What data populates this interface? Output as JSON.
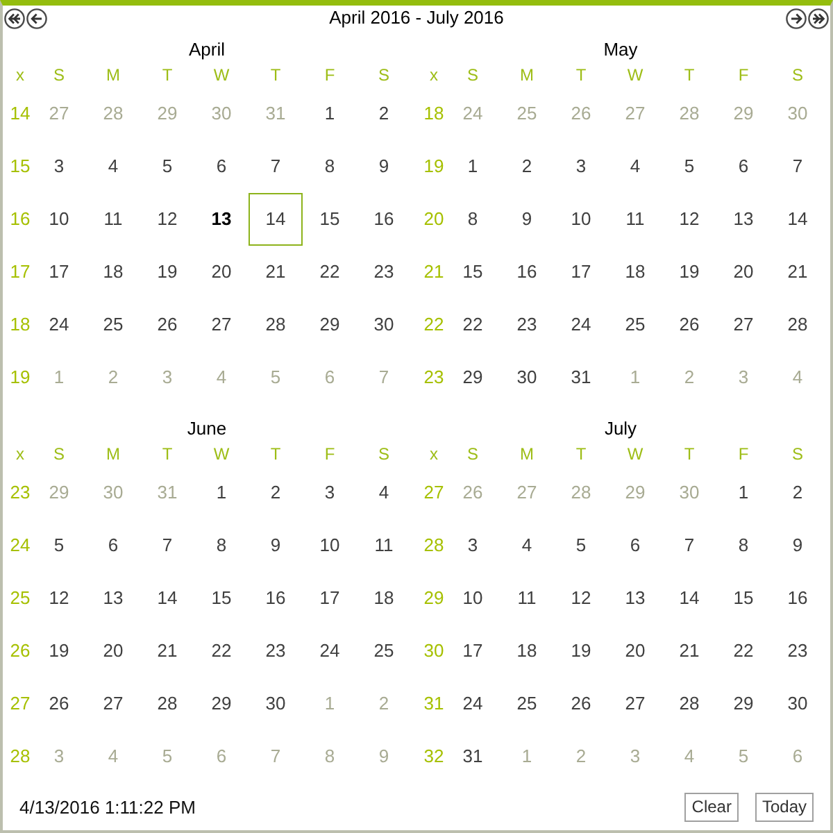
{
  "header": {
    "title": "April 2016 - July 2016"
  },
  "months": [
    {
      "name": "April",
      "weekdays": [
        "x",
        "S",
        "M",
        "T",
        "W",
        "T",
        "F",
        "S"
      ],
      "weeks": [
        {
          "number": "14",
          "days": [
            {
              "day": "27",
              "other_month": true,
              "today": false,
              "selected": false
            },
            {
              "day": "28",
              "other_month": true,
              "today": false,
              "selected": false
            },
            {
              "day": "29",
              "other_month": true,
              "today": false,
              "selected": false
            },
            {
              "day": "30",
              "other_month": true,
              "today": false,
              "selected": false
            },
            {
              "day": "31",
              "other_month": true,
              "today": false,
              "selected": false
            },
            {
              "day": "1",
              "other_month": false,
              "today": false,
              "selected": false
            },
            {
              "day": "2",
              "other_month": false,
              "today": false,
              "selected": false
            }
          ]
        },
        {
          "number": "15",
          "days": [
            {
              "day": "3",
              "other_month": false,
              "today": false,
              "selected": false
            },
            {
              "day": "4",
              "other_month": false,
              "today": false,
              "selected": false
            },
            {
              "day": "5",
              "other_month": false,
              "today": false,
              "selected": false
            },
            {
              "day": "6",
              "other_month": false,
              "today": false,
              "selected": false
            },
            {
              "day": "7",
              "other_month": false,
              "today": false,
              "selected": false
            },
            {
              "day": "8",
              "other_month": false,
              "today": false,
              "selected": false
            },
            {
              "day": "9",
              "other_month": false,
              "today": false,
              "selected": false
            }
          ]
        },
        {
          "number": "16",
          "days": [
            {
              "day": "10",
              "other_month": false,
              "today": false,
              "selected": false
            },
            {
              "day": "11",
              "other_month": false,
              "today": false,
              "selected": false
            },
            {
              "day": "12",
              "other_month": false,
              "today": false,
              "selected": false
            },
            {
              "day": "13",
              "other_month": false,
              "today": true,
              "selected": false
            },
            {
              "day": "14",
              "other_month": false,
              "today": false,
              "selected": true
            },
            {
              "day": "15",
              "other_month": false,
              "today": false,
              "selected": false
            },
            {
              "day": "16",
              "other_month": false,
              "today": false,
              "selected": false
            }
          ]
        },
        {
          "number": "17",
          "days": [
            {
              "day": "17",
              "other_month": false,
              "today": false,
              "selected": false
            },
            {
              "day": "18",
              "other_month": false,
              "today": false,
              "selected": false
            },
            {
              "day": "19",
              "other_month": false,
              "today": false,
              "selected": false
            },
            {
              "day": "20",
              "other_month": false,
              "today": false,
              "selected": false
            },
            {
              "day": "21",
              "other_month": false,
              "today": false,
              "selected": false
            },
            {
              "day": "22",
              "other_month": false,
              "today": false,
              "selected": false
            },
            {
              "day": "23",
              "other_month": false,
              "today": false,
              "selected": false
            }
          ]
        },
        {
          "number": "18",
          "days": [
            {
              "day": "24",
              "other_month": false,
              "today": false,
              "selected": false
            },
            {
              "day": "25",
              "other_month": false,
              "today": false,
              "selected": false
            },
            {
              "day": "26",
              "other_month": false,
              "today": false,
              "selected": false
            },
            {
              "day": "27",
              "other_month": false,
              "today": false,
              "selected": false
            },
            {
              "day": "28",
              "other_month": false,
              "today": false,
              "selected": false
            },
            {
              "day": "29",
              "other_month": false,
              "today": false,
              "selected": false
            },
            {
              "day": "30",
              "other_month": false,
              "today": false,
              "selected": false
            }
          ]
        },
        {
          "number": "19",
          "days": [
            {
              "day": "1",
              "other_month": true,
              "today": false,
              "selected": false
            },
            {
              "day": "2",
              "other_month": true,
              "today": false,
              "selected": false
            },
            {
              "day": "3",
              "other_month": true,
              "today": false,
              "selected": false
            },
            {
              "day": "4",
              "other_month": true,
              "today": false,
              "selected": false
            },
            {
              "day": "5",
              "other_month": true,
              "today": false,
              "selected": false
            },
            {
              "day": "6",
              "other_month": true,
              "today": false,
              "selected": false
            },
            {
              "day": "7",
              "other_month": true,
              "today": false,
              "selected": false
            }
          ]
        }
      ]
    },
    {
      "name": "May",
      "weekdays": [
        "x",
        "S",
        "M",
        "T",
        "W",
        "T",
        "F",
        "S"
      ],
      "weeks": [
        {
          "number": "18",
          "days": [
            {
              "day": "24",
              "other_month": true,
              "today": false,
              "selected": false
            },
            {
              "day": "25",
              "other_month": true,
              "today": false,
              "selected": false
            },
            {
              "day": "26",
              "other_month": true,
              "today": false,
              "selected": false
            },
            {
              "day": "27",
              "other_month": true,
              "today": false,
              "selected": false
            },
            {
              "day": "28",
              "other_month": true,
              "today": false,
              "selected": false
            },
            {
              "day": "29",
              "other_month": true,
              "today": false,
              "selected": false
            },
            {
              "day": "30",
              "other_month": true,
              "today": false,
              "selected": false
            }
          ]
        },
        {
          "number": "19",
          "days": [
            {
              "day": "1",
              "other_month": false,
              "today": false,
              "selected": false
            },
            {
              "day": "2",
              "other_month": false,
              "today": false,
              "selected": false
            },
            {
              "day": "3",
              "other_month": false,
              "today": false,
              "selected": false
            },
            {
              "day": "4",
              "other_month": false,
              "today": false,
              "selected": false
            },
            {
              "day": "5",
              "other_month": false,
              "today": false,
              "selected": false
            },
            {
              "day": "6",
              "other_month": false,
              "today": false,
              "selected": false
            },
            {
              "day": "7",
              "other_month": false,
              "today": false,
              "selected": false
            }
          ]
        },
        {
          "number": "20",
          "days": [
            {
              "day": "8",
              "other_month": false,
              "today": false,
              "selected": false
            },
            {
              "day": "9",
              "other_month": false,
              "today": false,
              "selected": false
            },
            {
              "day": "10",
              "other_month": false,
              "today": false,
              "selected": false
            },
            {
              "day": "11",
              "other_month": false,
              "today": false,
              "selected": false
            },
            {
              "day": "12",
              "other_month": false,
              "today": false,
              "selected": false
            },
            {
              "day": "13",
              "other_month": false,
              "today": false,
              "selected": false
            },
            {
              "day": "14",
              "other_month": false,
              "today": false,
              "selected": false
            }
          ]
        },
        {
          "number": "21",
          "days": [
            {
              "day": "15",
              "other_month": false,
              "today": false,
              "selected": false
            },
            {
              "day": "16",
              "other_month": false,
              "today": false,
              "selected": false
            },
            {
              "day": "17",
              "other_month": false,
              "today": false,
              "selected": false
            },
            {
              "day": "18",
              "other_month": false,
              "today": false,
              "selected": false
            },
            {
              "day": "19",
              "other_month": false,
              "today": false,
              "selected": false
            },
            {
              "day": "20",
              "other_month": false,
              "today": false,
              "selected": false
            },
            {
              "day": "21",
              "other_month": false,
              "today": false,
              "selected": false
            }
          ]
        },
        {
          "number": "22",
          "days": [
            {
              "day": "22",
              "other_month": false,
              "today": false,
              "selected": false
            },
            {
              "day": "23",
              "other_month": false,
              "today": false,
              "selected": false
            },
            {
              "day": "24",
              "other_month": false,
              "today": false,
              "selected": false
            },
            {
              "day": "25",
              "other_month": false,
              "today": false,
              "selected": false
            },
            {
              "day": "26",
              "other_month": false,
              "today": false,
              "selected": false
            },
            {
              "day": "27",
              "other_month": false,
              "today": false,
              "selected": false
            },
            {
              "day": "28",
              "other_month": false,
              "today": false,
              "selected": false
            }
          ]
        },
        {
          "number": "23",
          "days": [
            {
              "day": "29",
              "other_month": false,
              "today": false,
              "selected": false
            },
            {
              "day": "30",
              "other_month": false,
              "today": false,
              "selected": false
            },
            {
              "day": "31",
              "other_month": false,
              "today": false,
              "selected": false
            },
            {
              "day": "1",
              "other_month": true,
              "today": false,
              "selected": false
            },
            {
              "day": "2",
              "other_month": true,
              "today": false,
              "selected": false
            },
            {
              "day": "3",
              "other_month": true,
              "today": false,
              "selected": false
            },
            {
              "day": "4",
              "other_month": true,
              "today": false,
              "selected": false
            }
          ]
        }
      ]
    },
    {
      "name": "June",
      "weekdays": [
        "x",
        "S",
        "M",
        "T",
        "W",
        "T",
        "F",
        "S"
      ],
      "weeks": [
        {
          "number": "23",
          "days": [
            {
              "day": "29",
              "other_month": true,
              "today": false,
              "selected": false
            },
            {
              "day": "30",
              "other_month": true,
              "today": false,
              "selected": false
            },
            {
              "day": "31",
              "other_month": true,
              "today": false,
              "selected": false
            },
            {
              "day": "1",
              "other_month": false,
              "today": false,
              "selected": false
            },
            {
              "day": "2",
              "other_month": false,
              "today": false,
              "selected": false
            },
            {
              "day": "3",
              "other_month": false,
              "today": false,
              "selected": false
            },
            {
              "day": "4",
              "other_month": false,
              "today": false,
              "selected": false
            }
          ]
        },
        {
          "number": "24",
          "days": [
            {
              "day": "5",
              "other_month": false,
              "today": false,
              "selected": false
            },
            {
              "day": "6",
              "other_month": false,
              "today": false,
              "selected": false
            },
            {
              "day": "7",
              "other_month": false,
              "today": false,
              "selected": false
            },
            {
              "day": "8",
              "other_month": false,
              "today": false,
              "selected": false
            },
            {
              "day": "9",
              "other_month": false,
              "today": false,
              "selected": false
            },
            {
              "day": "10",
              "other_month": false,
              "today": false,
              "selected": false
            },
            {
              "day": "11",
              "other_month": false,
              "today": false,
              "selected": false
            }
          ]
        },
        {
          "number": "25",
          "days": [
            {
              "day": "12",
              "other_month": false,
              "today": false,
              "selected": false
            },
            {
              "day": "13",
              "other_month": false,
              "today": false,
              "selected": false
            },
            {
              "day": "14",
              "other_month": false,
              "today": false,
              "selected": false
            },
            {
              "day": "15",
              "other_month": false,
              "today": false,
              "selected": false
            },
            {
              "day": "16",
              "other_month": false,
              "today": false,
              "selected": false
            },
            {
              "day": "17",
              "other_month": false,
              "today": false,
              "selected": false
            },
            {
              "day": "18",
              "other_month": false,
              "today": false,
              "selected": false
            }
          ]
        },
        {
          "number": "26",
          "days": [
            {
              "day": "19",
              "other_month": false,
              "today": false,
              "selected": false
            },
            {
              "day": "20",
              "other_month": false,
              "today": false,
              "selected": false
            },
            {
              "day": "21",
              "other_month": false,
              "today": false,
              "selected": false
            },
            {
              "day": "22",
              "other_month": false,
              "today": false,
              "selected": false
            },
            {
              "day": "23",
              "other_month": false,
              "today": false,
              "selected": false
            },
            {
              "day": "24",
              "other_month": false,
              "today": false,
              "selected": false
            },
            {
              "day": "25",
              "other_month": false,
              "today": false,
              "selected": false
            }
          ]
        },
        {
          "number": "27",
          "days": [
            {
              "day": "26",
              "other_month": false,
              "today": false,
              "selected": false
            },
            {
              "day": "27",
              "other_month": false,
              "today": false,
              "selected": false
            },
            {
              "day": "28",
              "other_month": false,
              "today": false,
              "selected": false
            },
            {
              "day": "29",
              "other_month": false,
              "today": false,
              "selected": false
            },
            {
              "day": "30",
              "other_month": false,
              "today": false,
              "selected": false
            },
            {
              "day": "1",
              "other_month": true,
              "today": false,
              "selected": false
            },
            {
              "day": "2",
              "other_month": true,
              "today": false,
              "selected": false
            }
          ]
        },
        {
          "number": "28",
          "days": [
            {
              "day": "3",
              "other_month": true,
              "today": false,
              "selected": false
            },
            {
              "day": "4",
              "other_month": true,
              "today": false,
              "selected": false
            },
            {
              "day": "5",
              "other_month": true,
              "today": false,
              "selected": false
            },
            {
              "day": "6",
              "other_month": true,
              "today": false,
              "selected": false
            },
            {
              "day": "7",
              "other_month": true,
              "today": false,
              "selected": false
            },
            {
              "day": "8",
              "other_month": true,
              "today": false,
              "selected": false
            },
            {
              "day": "9",
              "other_month": true,
              "today": false,
              "selected": false
            }
          ]
        }
      ]
    },
    {
      "name": "July",
      "weekdays": [
        "x",
        "S",
        "M",
        "T",
        "W",
        "T",
        "F",
        "S"
      ],
      "weeks": [
        {
          "number": "27",
          "days": [
            {
              "day": "26",
              "other_month": true,
              "today": false,
              "selected": false
            },
            {
              "day": "27",
              "other_month": true,
              "today": false,
              "selected": false
            },
            {
              "day": "28",
              "other_month": true,
              "today": false,
              "selected": false
            },
            {
              "day": "29",
              "other_month": true,
              "today": false,
              "selected": false
            },
            {
              "day": "30",
              "other_month": true,
              "today": false,
              "selected": false
            },
            {
              "day": "1",
              "other_month": false,
              "today": false,
              "selected": false
            },
            {
              "day": "2",
              "other_month": false,
              "today": false,
              "selected": false
            }
          ]
        },
        {
          "number": "28",
          "days": [
            {
              "day": "3",
              "other_month": false,
              "today": false,
              "selected": false
            },
            {
              "day": "4",
              "other_month": false,
              "today": false,
              "selected": false
            },
            {
              "day": "5",
              "other_month": false,
              "today": false,
              "selected": false
            },
            {
              "day": "6",
              "other_month": false,
              "today": false,
              "selected": false
            },
            {
              "day": "7",
              "other_month": false,
              "today": false,
              "selected": false
            },
            {
              "day": "8",
              "other_month": false,
              "today": false,
              "selected": false
            },
            {
              "day": "9",
              "other_month": false,
              "today": false,
              "selected": false
            }
          ]
        },
        {
          "number": "29",
          "days": [
            {
              "day": "10",
              "other_month": false,
              "today": false,
              "selected": false
            },
            {
              "day": "11",
              "other_month": false,
              "today": false,
              "selected": false
            },
            {
              "day": "12",
              "other_month": false,
              "today": false,
              "selected": false
            },
            {
              "day": "13",
              "other_month": false,
              "today": false,
              "selected": false
            },
            {
              "day": "14",
              "other_month": false,
              "today": false,
              "selected": false
            },
            {
              "day": "15",
              "other_month": false,
              "today": false,
              "selected": false
            },
            {
              "day": "16",
              "other_month": false,
              "today": false,
              "selected": false
            }
          ]
        },
        {
          "number": "30",
          "days": [
            {
              "day": "17",
              "other_month": false,
              "today": false,
              "selected": false
            },
            {
              "day": "18",
              "other_month": false,
              "today": false,
              "selected": false
            },
            {
              "day": "19",
              "other_month": false,
              "today": false,
              "selected": false
            },
            {
              "day": "20",
              "other_month": false,
              "today": false,
              "selected": false
            },
            {
              "day": "21",
              "other_month": false,
              "today": false,
              "selected": false
            },
            {
              "day": "22",
              "other_month": false,
              "today": false,
              "selected": false
            },
            {
              "day": "23",
              "other_month": false,
              "today": false,
              "selected": false
            }
          ]
        },
        {
          "number": "31",
          "days": [
            {
              "day": "24",
              "other_month": false,
              "today": false,
              "selected": false
            },
            {
              "day": "25",
              "other_month": false,
              "today": false,
              "selected": false
            },
            {
              "day": "26",
              "other_month": false,
              "today": false,
              "selected": false
            },
            {
              "day": "27",
              "other_month": false,
              "today": false,
              "selected": false
            },
            {
              "day": "28",
              "other_month": false,
              "today": false,
              "selected": false
            },
            {
              "day": "29",
              "other_month": false,
              "today": false,
              "selected": false
            },
            {
              "day": "30",
              "other_month": false,
              "today": false,
              "selected": false
            }
          ]
        },
        {
          "number": "32",
          "days": [
            {
              "day": "31",
              "other_month": false,
              "today": false,
              "selected": false
            },
            {
              "day": "1",
              "other_month": true,
              "today": false,
              "selected": false
            },
            {
              "day": "2",
              "other_month": true,
              "today": false,
              "selected": false
            },
            {
              "day": "3",
              "other_month": true,
              "today": false,
              "selected": false
            },
            {
              "day": "4",
              "other_month": true,
              "today": false,
              "selected": false
            },
            {
              "day": "5",
              "other_month": true,
              "today": false,
              "selected": false
            },
            {
              "day": "6",
              "other_month": true,
              "today": false,
              "selected": false
            }
          ]
        }
      ]
    }
  ],
  "footer": {
    "timestamp": "4/13/2016 1:11:22 PM",
    "buttons": [
      {
        "label": "Clear"
      },
      {
        "label": "Today"
      }
    ]
  }
}
